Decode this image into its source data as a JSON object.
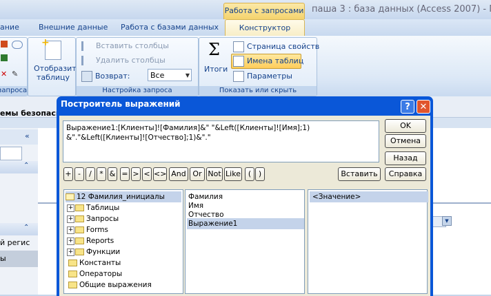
{
  "window": {
    "context_tab": "Работа с запросами",
    "title": "паша 3 : база данных (Access 2007) - Micro"
  },
  "tabs": [
    "ание",
    "Внешние данные",
    "Работа с базами данных"
  ],
  "active_tab": "Конструктор",
  "ribbon": {
    "query_setup": {
      "insert_columns": "Вставить столбцы",
      "delete_columns": "Удалить столбцы",
      "return_label": "Возврат:",
      "return_value": "Все",
      "group_label": "Настройка запроса"
    },
    "show_hide": {
      "totals": "Итоги",
      "property_sheet": "Страница свойств",
      "table_names": "Имена таблиц",
      "parameters": "Параметры",
      "group_label": "Показать или скрыть"
    },
    "results": {
      "show_table": "Отобразить таблицу"
    },
    "left_group_label": "запроса"
  },
  "background": {
    "msg_text": "емы безопасно",
    "left_item1": "й регис",
    "left_item2": "ы"
  },
  "dialog": {
    "title": "Построитель выражений",
    "expression_line1": "Выражение1:[Клиенты]![Фамилия]&\" \"&Left([Клиенты]![Имя];1)",
    "expression_line2": "&\".\"&Left([Клиенты]![Отчество];1)&\".\"",
    "buttons": {
      "ok": "OK",
      "cancel": "Отмена",
      "back": "Назад",
      "help": "Справка",
      "paste": "Вставить"
    },
    "operators": [
      "+",
      "-",
      "/",
      "*",
      "&",
      "=",
      ">",
      "<",
      "<>",
      "And",
      "Or",
      "Not",
      "Like",
      "(",
      ")"
    ],
    "tree": [
      {
        "label": "12 Фамилия_инициалы",
        "kind": "open",
        "selected": true
      },
      {
        "label": "Таблицы",
        "kind": "plus"
      },
      {
        "label": "Запросы",
        "kind": "plus"
      },
      {
        "label": "Forms",
        "kind": "plus"
      },
      {
        "label": "Reports",
        "kind": "plus"
      },
      {
        "label": "Функции",
        "kind": "plus"
      },
      {
        "label": "Константы",
        "kind": "folder"
      },
      {
        "label": "Операторы",
        "kind": "folder"
      },
      {
        "label": "Общие выражения",
        "kind": "folder"
      }
    ],
    "fields": [
      "Фамилия",
      "Имя",
      "Отчество",
      "Выражение1"
    ],
    "selected_field": "Выражение1",
    "values": [
      "<Значение>"
    ]
  }
}
